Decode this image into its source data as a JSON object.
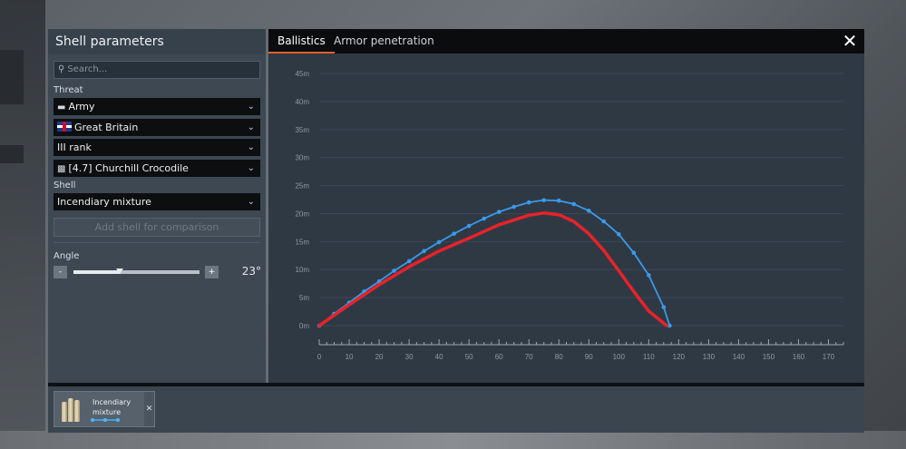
{
  "left_panel": {
    "title": "Shell parameters",
    "search_placeholder": "Search...",
    "threat_label": "Threat",
    "threat": {
      "country_type": "Army",
      "nation": "Great Britain",
      "rank": "III rank",
      "vehicle": "[4.7] Churchill Crocodile"
    },
    "shell_label": "Shell",
    "shell_value": "Incendiary mixture",
    "add_button": "Add shell for comparison",
    "angle_label": "Angle",
    "angle_minus": "-",
    "angle_plus": "+",
    "angle_value": "23°",
    "angle_fraction": 0.37
  },
  "tabs": [
    {
      "label": "Ballistics",
      "active": true
    },
    {
      "label": "Armor penetration",
      "active": false
    }
  ],
  "icons": {
    "close": "close-icon",
    "search": "search-icon",
    "army": "tank-icon",
    "flag": "uk-flag-icon",
    "vehicle": "tank-icon"
  },
  "bottom": {
    "card_label": "Incendiary mixture"
  },
  "chart_data": {
    "type": "line",
    "title": "",
    "xlabel": "",
    "ylabel": "",
    "x_ticks": [
      0,
      10,
      20,
      30,
      40,
      50,
      60,
      70,
      80,
      90,
      100,
      110,
      120,
      130,
      140,
      150,
      160,
      170
    ],
    "y_ticks": [
      "0m",
      "5m",
      "10m",
      "15m",
      "20m",
      "25m",
      "30m",
      "35m",
      "40m",
      "45m"
    ],
    "xlim": [
      0,
      175
    ],
    "ylim": [
      0,
      45
    ],
    "grid": true,
    "series": [
      {
        "color": "#3b9aea",
        "markers": true,
        "x": [
          0,
          5,
          10,
          15,
          20,
          25,
          30,
          35,
          40,
          45,
          50,
          55,
          60,
          65,
          70,
          75,
          80,
          85,
          90,
          95,
          100,
          105,
          110,
          115,
          117
        ],
        "y": [
          0,
          2.1,
          4.1,
          6.1,
          7.9,
          9.8,
          11.5,
          13.3,
          14.9,
          16.4,
          17.8,
          19.1,
          20.3,
          21.2,
          22.0,
          22.4,
          22.3,
          21.7,
          20.5,
          18.6,
          16.3,
          13.0,
          9.0,
          3.3,
          0
        ]
      },
      {
        "color": "#e8222a",
        "markers": false,
        "x": [
          0,
          10,
          20,
          30,
          40,
          50,
          60,
          70,
          75,
          80,
          85,
          90,
          95,
          100,
          105,
          110,
          116
        ],
        "y": [
          0,
          3.7,
          7.3,
          10.5,
          13.3,
          15.6,
          18.0,
          19.7,
          20.1,
          19.8,
          18.6,
          16.4,
          13.4,
          9.8,
          6.1,
          2.6,
          0
        ]
      }
    ]
  }
}
